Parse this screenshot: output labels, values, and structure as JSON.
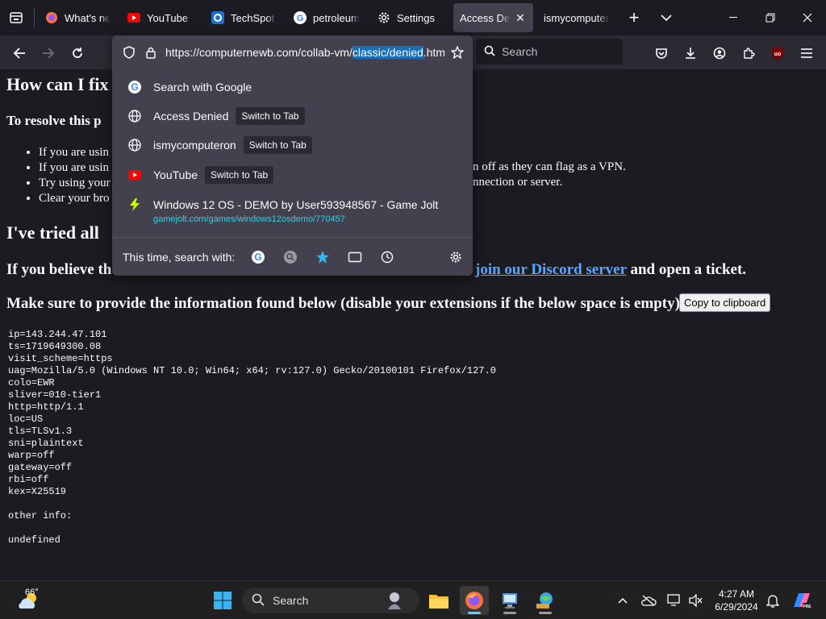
{
  "tabs": [
    {
      "title": "What's new",
      "favicon": "firefox-icon"
    },
    {
      "title": "YouTube",
      "favicon": "youtube-icon"
    },
    {
      "title": "TechSpot | ",
      "favicon": "techspot-icon"
    },
    {
      "title": "petroleum",
      "favicon": "google-icon"
    },
    {
      "title": "Settings",
      "favicon": "gear-icon"
    },
    {
      "title": "Access Denie",
      "favicon": "",
      "active": true
    },
    {
      "title": "ismycomputer",
      "favicon": ""
    }
  ],
  "urlbar": {
    "url_before": "https://computernewb.com/collab-vm/",
    "url_selected": "classic/denied",
    "url_after": ".htm"
  },
  "search": {
    "placeholder": "Search"
  },
  "suggestions": [
    {
      "label": "Search with Google",
      "icon": "google-icon"
    },
    {
      "label": "Access Denied",
      "icon": "globe-icon",
      "action": "Switch to Tab"
    },
    {
      "label": "ismycomputeron",
      "icon": "globe-icon",
      "action": "Switch to Tab"
    },
    {
      "label": "YouTube",
      "icon": "youtube-icon",
      "action": "Switch to Tab"
    },
    {
      "label": "Windows 12 OS - DEMO by User593948567 - Game Jolt",
      "icon": "gamejolt-icon",
      "url": "gamejolt.com/games/windows12osdemo/770457"
    }
  ],
  "search_with": {
    "label": "This time, search with:"
  },
  "page": {
    "h1": "How can I fix",
    "h3": "To resolve this p",
    "bullets": [
      "If you are usin",
      "If you are usin",
      "Try using your",
      "Clear your bro"
    ],
    "bullet_right": [
      "n off as they can flag as a VPN.",
      "nnection or server."
    ],
    "h2": "I've tried all",
    "believe_start": "If you believe th",
    "discord_link": "join our Discord server",
    "believe_end": " and open a ticket.",
    "make_sure": "Make sure to provide the information found below (disable your extensions if the below space is empty):",
    "copy_button": "Copy to clipboard",
    "info": "ip=143.244.47.101\nts=1719649300.08\nvisit_scheme=https\nuag=Mozilla/5.0 (Windows NT 10.0; Win64; x64; rv:127.0) Gecko/20100101 Firefox/127.0\ncolo=EWR\nsliver=010-tier1\nhttp=http/1.1\nloc=US\ntls=TLSv1.3\nsni=plaintext\nwarp=off\ngateway=off\nrbi=off\nkex=X25519\n\nother info:\n\nundefined"
  },
  "taskbar": {
    "temperature": "66°",
    "search_label": "Search",
    "time": "4:27 AM",
    "date": "6/29/2024"
  },
  "colors": {
    "accent": "#0a84ff",
    "link": "#5aa6ff",
    "url_highlight": "#1a6fb8"
  }
}
